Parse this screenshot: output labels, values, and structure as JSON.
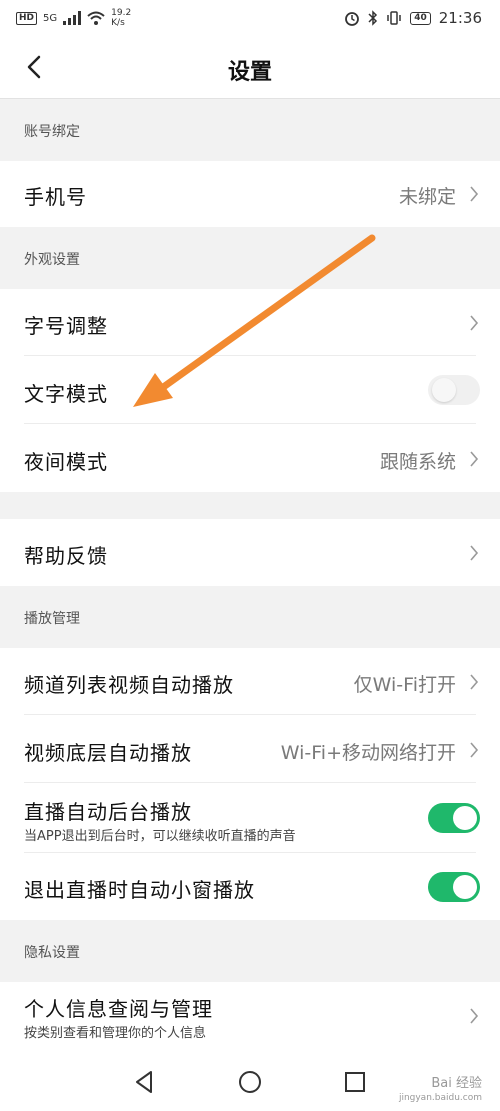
{
  "status_bar": {
    "network": "HD",
    "signal": "5G",
    "speed_value": "19.2",
    "speed_unit": "K/s",
    "battery": "40",
    "time": "21:36"
  },
  "header": {
    "title": "设置"
  },
  "sections": {
    "account": {
      "header": "账号绑定",
      "phone_label": "手机号",
      "phone_value": "未绑定"
    },
    "appearance": {
      "header": "外观设置",
      "font_label": "字号调整",
      "text_mode_label": "文字模式",
      "text_mode_on": false,
      "night_label": "夜间模式",
      "night_value": "跟随系统"
    },
    "help": {
      "label": "帮助反馈"
    },
    "playback": {
      "header": "播放管理",
      "channel_label": "频道列表视频自动播放",
      "channel_value": "仅Wi-Fi打开",
      "bottom_label": "视频底层自动播放",
      "bottom_value": "Wi-Fi+移动网络打开",
      "live_bg_label": "直播自动后台播放",
      "live_bg_sub": "当APP退出到后台时，可以继续收听直播的声音",
      "live_bg_on": true,
      "mini_label": "退出直播时自动小窗播放",
      "mini_on": true
    },
    "privacy": {
      "header": "隐私设置",
      "info_label": "个人信息查阅与管理",
      "info_sub": "按类别查看和管理你的个人信息"
    }
  },
  "watermark": {
    "main": "Bai 经验",
    "sub": "jingyan.baidu.com"
  },
  "colors": {
    "toggle_on": "#1fb86b",
    "annotation_arrow": "#f28a30"
  }
}
